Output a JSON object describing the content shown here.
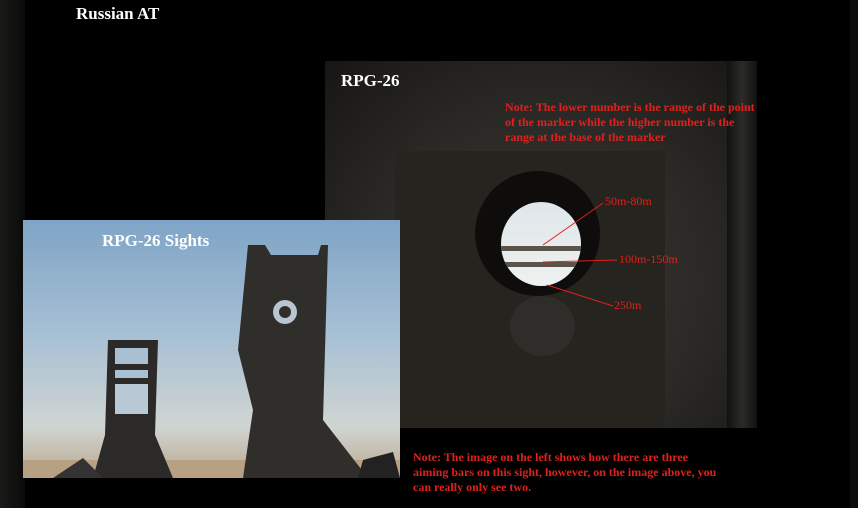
{
  "page": {
    "title": "Russian AT"
  },
  "scope_image": {
    "title": "RPG-26",
    "note": "Note: The lower number is the range of the point of the marker while the higher number is the range at the base of the marker",
    "range_labels": [
      "50m-80m",
      "100m-150m",
      "250m"
    ]
  },
  "sights_image": {
    "title": "RPG-26 Sights"
  },
  "bottom_note": "Note: The image on the left shows how there are three aiming bars on this sight, however, on the image above, you can really only see two.",
  "colors": {
    "note_text": "#e0201c",
    "background": "#000000",
    "title_text": "#ffffff"
  }
}
